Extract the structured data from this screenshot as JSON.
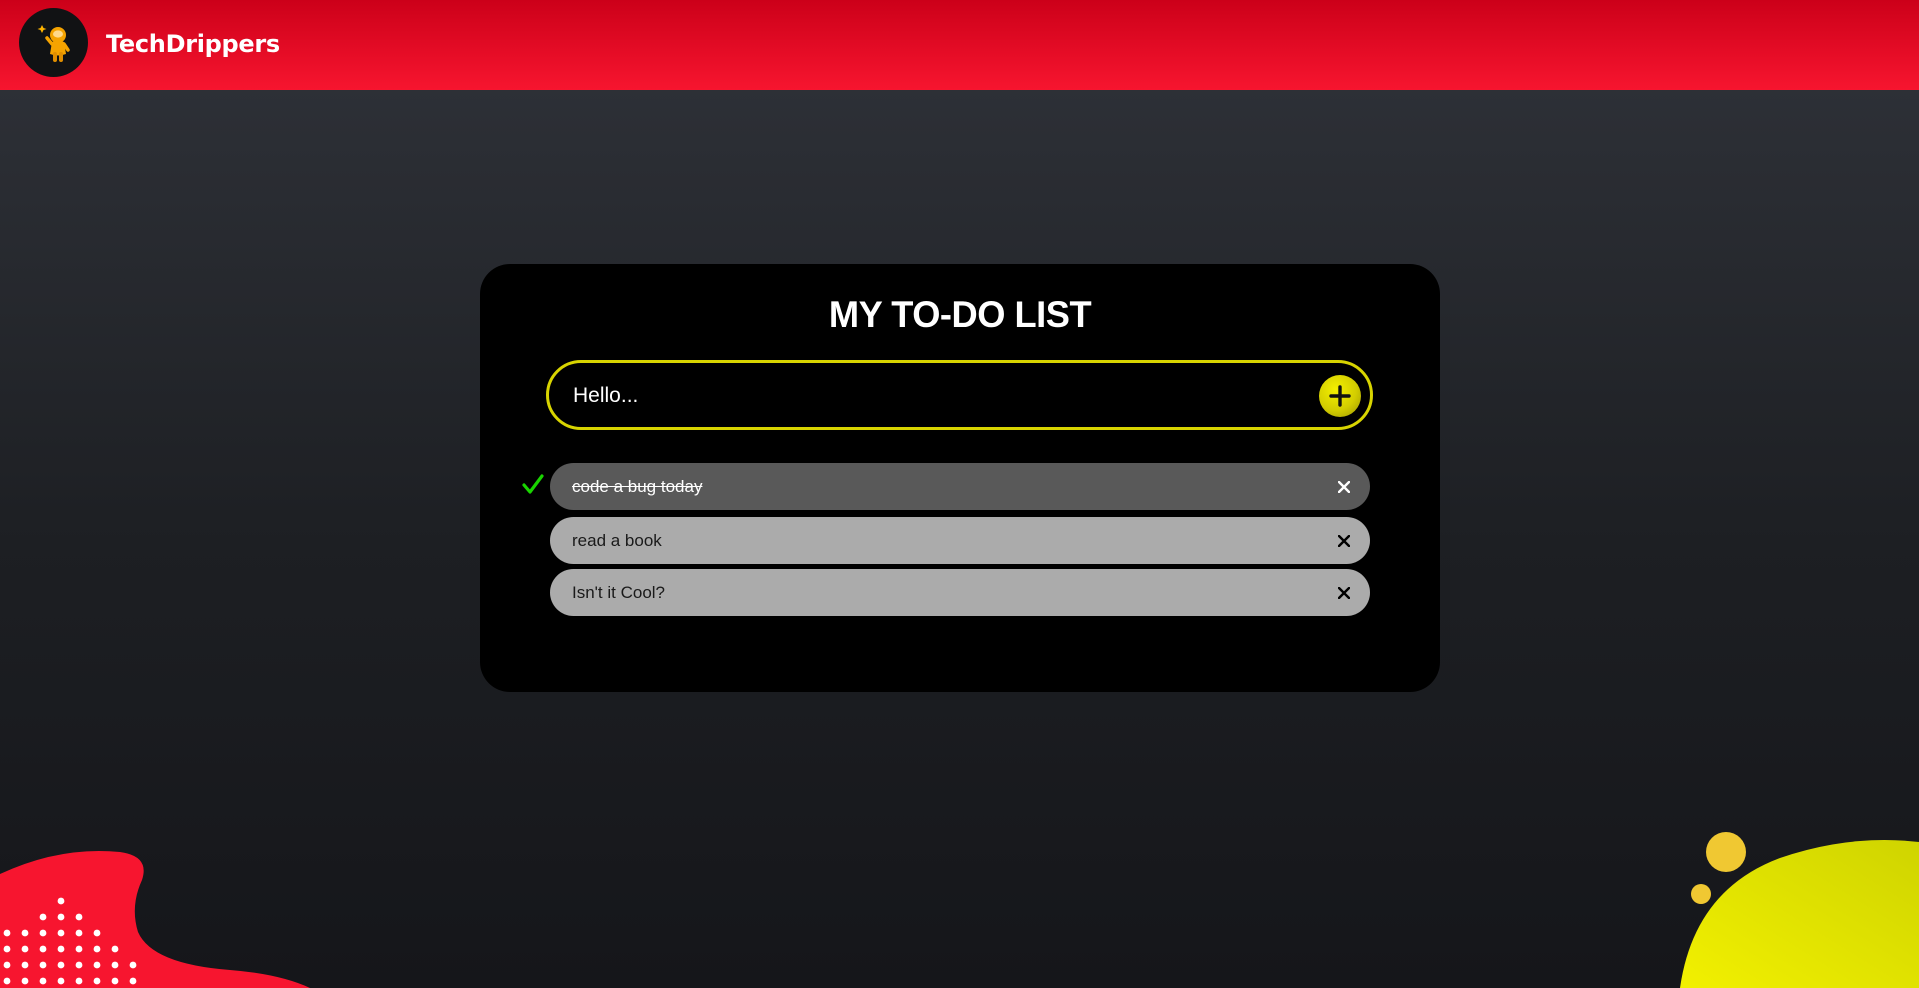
{
  "header": {
    "brand": "TechDrippers",
    "logo_icon": "astronaut-logo-icon"
  },
  "todo": {
    "title": "MY TO-DO LIST",
    "input_placeholder": "Hello...",
    "add_icon": "plus-icon",
    "items": [
      {
        "text": "code a bug today",
        "completed": true
      },
      {
        "text": "read a book",
        "completed": false
      },
      {
        "text": "Isn't it Cool?",
        "completed": false
      }
    ]
  },
  "colors": {
    "header_red": "#f7152f",
    "accent_yellow": "#d8d400",
    "completed_item": "#595959",
    "pending_item": "#ababab",
    "check_green": "#19d400"
  }
}
